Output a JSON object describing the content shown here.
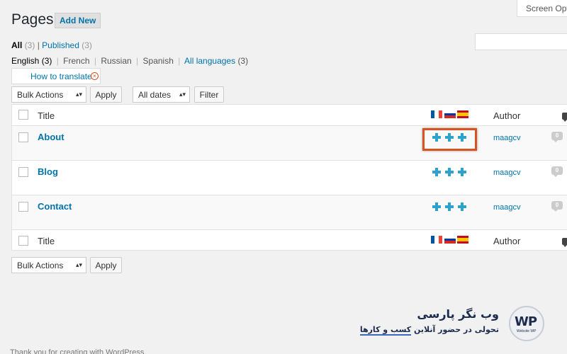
{
  "header": {
    "title": "Pages",
    "add_new_label": "Add New",
    "screen_options_label": "Screen Optio"
  },
  "status_filter": {
    "all_label": "All",
    "all_count": "(3)",
    "separator": "|",
    "published_label": "Published",
    "published_count": "(3)"
  },
  "language_filter": {
    "english_label": "English (3)",
    "french_label": "French",
    "russian_label": "Russian",
    "spanish_label": "Spanish",
    "all_languages_label": "All languages",
    "all_languages_count": "(3)"
  },
  "how_to_translate": {
    "label": "How to translate"
  },
  "top_actions": {
    "bulk_actions": "Bulk Actions",
    "apply": "Apply",
    "all_dates": "All dates",
    "filter": "Filter"
  },
  "table": {
    "header_title": "Title",
    "header_author": "Author",
    "footer_title": "Title",
    "footer_author": "Author",
    "rows": [
      {
        "title": "About",
        "author": "maagcv",
        "comments": "0"
      },
      {
        "title": "Blog",
        "author": "maagcv",
        "comments": "0"
      },
      {
        "title": "Contact",
        "author": "maagcv",
        "comments": "0"
      }
    ],
    "flag_colors": {
      "fr": [
        "#0055a4",
        "#ffffff",
        "#ef4135"
      ],
      "ru": [
        "#ffffff",
        "#0039a6",
        "#d52b1e"
      ],
      "es": [
        "#c60b1e",
        "#ffc400",
        "#c60b1e"
      ]
    },
    "highlight_color": "#d9531e"
  },
  "bottom_actions": {
    "bulk_actions": "Bulk Actions",
    "apply": "Apply"
  },
  "watermark": {
    "brand": "وب نگر پارسی",
    "tagline_prefix": "تحولی در حضور آنلاین ",
    "tagline_underlined": "کسب و کارها",
    "logo_text": "WP",
    "logo_small": "Website WP"
  },
  "footer": {
    "text": "Thank you for creating with WordPress."
  }
}
